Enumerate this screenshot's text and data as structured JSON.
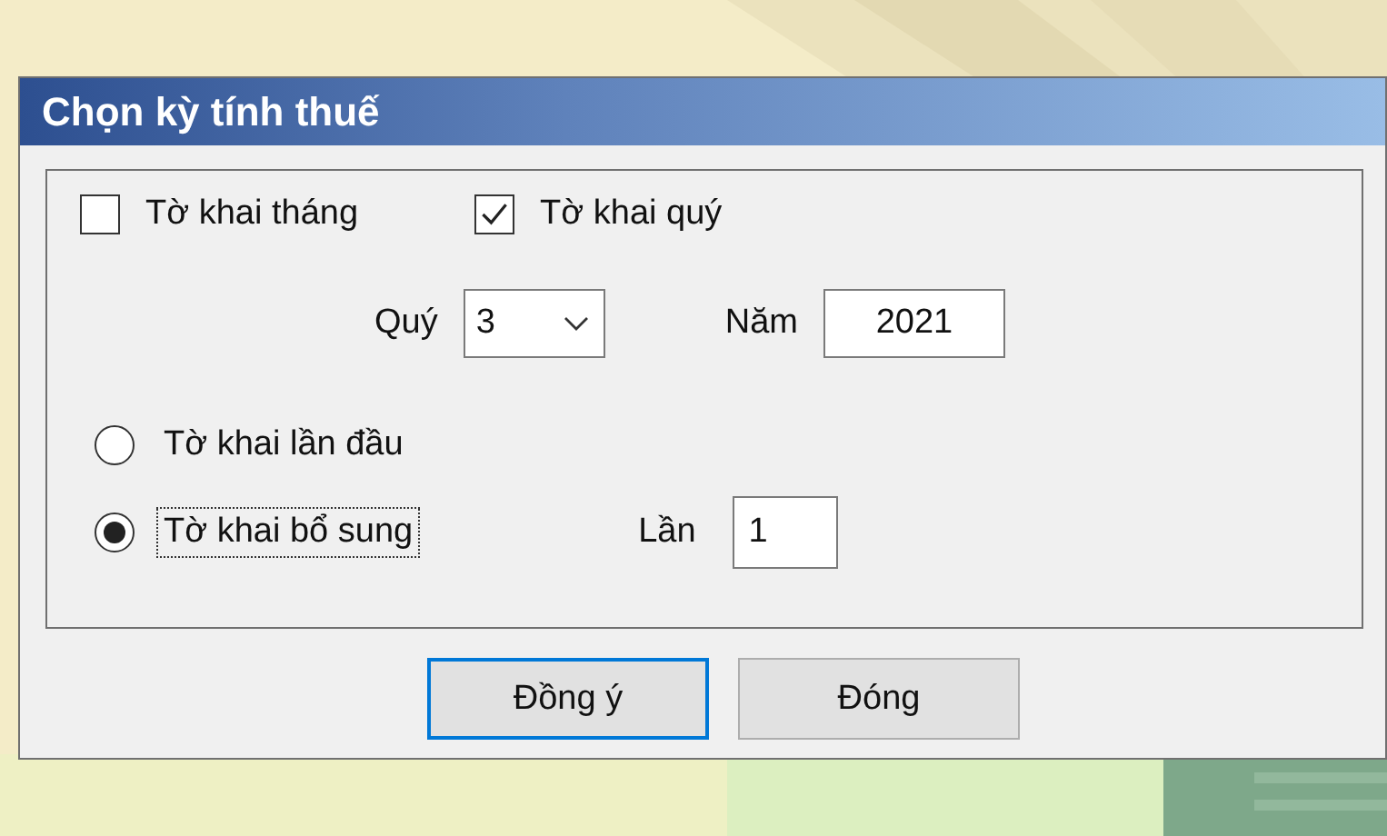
{
  "window": {
    "title": "Chọn kỳ tính thuế"
  },
  "declaration_types": [
    {
      "label": "Tờ khai tháng",
      "checked": false
    },
    {
      "label": "Tờ khai quý",
      "checked": true
    }
  ],
  "period": {
    "quarter_label": "Quý",
    "quarter_value": "3",
    "year_label": "Năm",
    "year_value": "2021"
  },
  "filing_options": [
    {
      "label": "Tờ khai lần đầu",
      "selected": false,
      "focused": false
    },
    {
      "label": "Tờ khai bổ sung",
      "selected": true,
      "focused": true
    }
  ],
  "revision": {
    "label": "Lần",
    "value": "1"
  },
  "buttons": [
    {
      "label": "Đồng ý",
      "default": true
    },
    {
      "label": "Đóng",
      "default": false
    }
  ]
}
